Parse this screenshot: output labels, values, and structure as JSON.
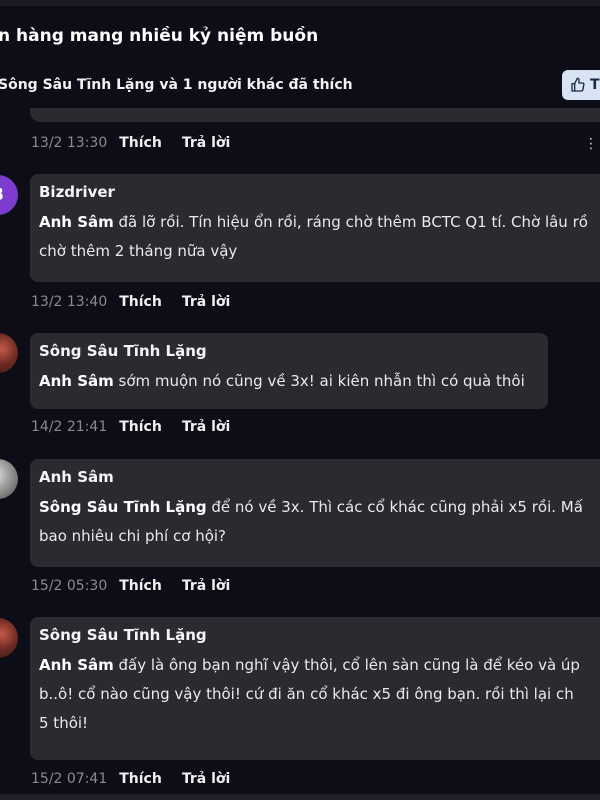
{
  "post": {
    "title": "n hàng mang nhiều kỷ niệm buồn",
    "likes_text": "Sông Sâu Tĩnh Lặng và 1 người khác đã thích",
    "like_button_label": "T"
  },
  "actions": {
    "like": "Thích",
    "reply": "Trả lời"
  },
  "first_meta": {
    "time": "13/2 13:30"
  },
  "comments": [
    {
      "avatar_letter": "B",
      "author": "Bizdriver",
      "mention": "Anh Sâm",
      "line1": " đã lỡ rồi. Tín hiệu ổn rồi, ráng chờ thêm BCTC Q1 tí. Chờ lâu rồ",
      "line2": "chờ thêm 2 tháng nữa vậy",
      "time": "13/2 13:40"
    },
    {
      "author": "Sông Sâu Tĩnh Lặng",
      "mention": "Anh Sâm",
      "line1": " sớm muộn nó cũng về 3x! ai kiên nhẫn thì có quà thôi",
      "time": "14/2 21:41"
    },
    {
      "author": "Anh Sâm",
      "mention": "Sông Sâu Tĩnh Lặng",
      "line1": " để nó về 3x. Thì các cổ khác cũng phải x5 rồi. Mấ",
      "line2": "bao nhiêu chi phí cơ hội?",
      "time": "15/2 05:30"
    },
    {
      "author": "Sông Sâu Tĩnh Lặng",
      "mention": "Anh Sâm",
      "line1": " đấy là ông bạn nghĩ vậy thôi, cổ lên sàn cũng là để kéo và úp",
      "line2": "b..ô! cổ nào cũng vậy thôi! cứ đi ăn cổ khác x5 đi ông bạn. rồi thì lại ch",
      "line3": "5 thôi!",
      "time": "15/2 07:41"
    }
  ],
  "more_icon_text": "⋮"
}
